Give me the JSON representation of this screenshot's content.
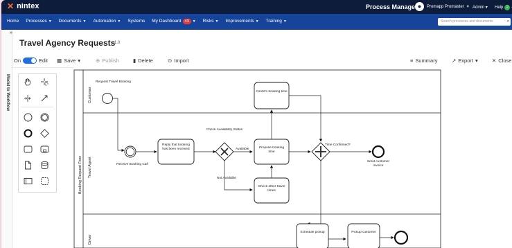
{
  "topbar": {
    "brand": "nintex",
    "product": "Process Manager",
    "user": "Promapp Promaster",
    "admin": "Admin",
    "help": "Help",
    "help_count": "2"
  },
  "nav": {
    "items": [
      "Home",
      "Processes",
      "Documents",
      "Automation",
      "Systems",
      "My Dashboard",
      "Risks",
      "Improvements",
      "Training"
    ],
    "dashboard_badge": "43",
    "search_placeholder": "Search processes and documents"
  },
  "sidebar": {
    "vertical_label": "Model to Workflow"
  },
  "page": {
    "title": "Travel Agency Requests",
    "version": "v1.0"
  },
  "toolbar": {
    "on": "On",
    "edit": "Edit",
    "save": "Save",
    "publish": "Publish",
    "delete": "Delete",
    "import": "Import",
    "summary": "Summary",
    "export": "Export",
    "close": "Close"
  },
  "diagram": {
    "pool": "Booking Request Flow",
    "lanes": [
      "Customer",
      "Travel Agent",
      "Driver"
    ],
    "start_label": "Request Travel Booking",
    "receive_label": "Receive Booking Call",
    "reply_task": "Reply that booking has been received",
    "gateway1_label": "Check Availability Status",
    "available": "Available",
    "not_available": "Not Available",
    "propose_task": "Propose booking time",
    "confirm_task": "Confirm booking time",
    "check_other_task": "Check other travel times",
    "gateway2_label": "Time Confirmed?",
    "invoice_label": "Send customer invoice",
    "schedule_task": "Schedule pickup",
    "pickup_task": "Pickup customer"
  },
  "colors": {
    "topbar": "#0c1c3a",
    "navbar": "#15449a",
    "accent": "#1f6fe0",
    "badge": "#e23b3b"
  }
}
